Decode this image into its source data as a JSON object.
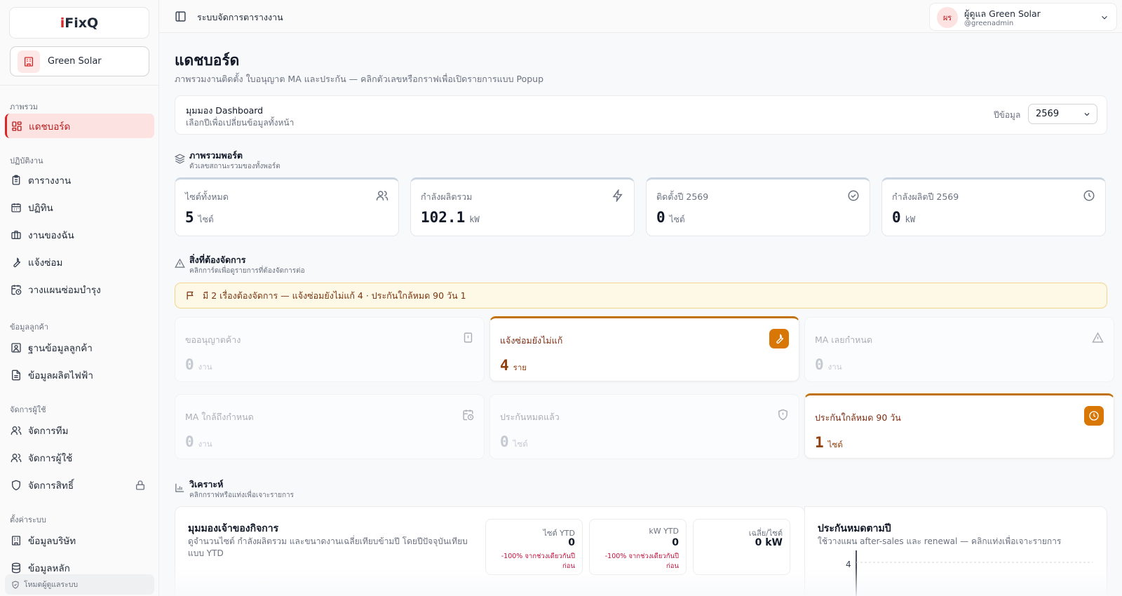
{
  "brand": {
    "logo_i": "i",
    "logo_rest": "FixQ"
  },
  "org": {
    "name": "Green Solar",
    "icon": "building-icon"
  },
  "sidebar": {
    "sections": [
      {
        "label": "ภาพรวม",
        "items": [
          {
            "label": "แดชบอร์ด",
            "icon": "dashboard-icon",
            "active": true
          }
        ]
      },
      {
        "label": "ปฏิบัติงาน",
        "items": [
          {
            "label": "ตารางงาน",
            "icon": "clipboard-icon"
          },
          {
            "label": "ปฏิทิน",
            "icon": "calendar-icon"
          },
          {
            "label": "งานของฉัน",
            "icon": "briefcase-icon"
          },
          {
            "label": "แจ้งซ่อม",
            "icon": "wrench-icon"
          },
          {
            "label": "วางแผนซ่อมบำรุง",
            "icon": "calendar-clock-icon"
          }
        ]
      },
      {
        "label": "ข้อมูลลูกค้า",
        "items": [
          {
            "label": "ฐานข้อมูลลูกค้า",
            "icon": "contact-icon"
          },
          {
            "label": "ข้อมูลผลิตไฟฟ้า",
            "icon": "document-icon"
          }
        ]
      },
      {
        "label": "จัดการผู้ใช้",
        "items": [
          {
            "label": "จัดการทีม",
            "icon": "users-icon"
          },
          {
            "label": "จัดการผู้ใช้",
            "icon": "users-icon"
          },
          {
            "label": "จัดการสิทธิ์",
            "icon": "shield-icon",
            "lock": true
          }
        ]
      },
      {
        "label": "ตั้งค่าระบบ",
        "items": [
          {
            "label": "ข้อมูลบริษัท",
            "icon": "building-icon"
          },
          {
            "label": "ข้อมูลหลัก",
            "icon": "database-icon"
          }
        ]
      }
    ],
    "footer": "โหมดผู้ดูแลระบบ"
  },
  "topbar": {
    "title": "ระบบจัดการตารางงาน"
  },
  "user": {
    "initials": "ผร",
    "name": "ผู้ดูแล Green Solar",
    "handle": "@greenadmin"
  },
  "page": {
    "title": "แดชบอร์ด",
    "subtitle": "ภาพรวมงานติดตั้ง ใบอนุญาต MA และประกัน — คลิกตัวเลขหรือกราฟเพื่อเปิดรายการแบบ Popup"
  },
  "dashboard_view": {
    "title": "มุมมอง Dashboard",
    "subtitle": "เลือกปีเพื่อเปลี่ยนข้อมูลทั้งหน้า",
    "year_label": "ปีข้อมูล",
    "year_value": "2569"
  },
  "portfolio": {
    "title": "ภาพรวมพอร์ต",
    "subtitle": "ตัวเลขสถานะรวมของทั้งพอร์ต",
    "cards": [
      {
        "label": "ไซต์ทั้งหมด",
        "value": "5",
        "unit": "ไซต์",
        "icon": "users-icon"
      },
      {
        "label": "กำลังผลิตรวม",
        "value": "102.1",
        "unit": "kW",
        "icon": "lightning-icon"
      },
      {
        "label": "ติดตั้งปี 2569",
        "value": "0",
        "unit": "ไซต์",
        "icon": "check-circle-icon"
      },
      {
        "label": "กำลังผลิตปี 2569",
        "value": "0",
        "unit": "kW",
        "icon": "clock-icon"
      }
    ]
  },
  "todo": {
    "title": "สิ่งที่ต้องจัดการ",
    "subtitle": "คลิกการ์ดเพื่อดูรายการที่ต้องจัดการต่อ",
    "alert": "มี 2 เรื่องต้องจัดการ — แจ้งซ่อมยังไม่แก้ 4 · ประกันใกล้หมด 90 วัน 1",
    "tiles": [
      {
        "label": "ขออนุญาตค้าง",
        "value": "0",
        "unit": "งาน",
        "icon": "alert-square-icon",
        "highlight": false
      },
      {
        "label": "แจ้งซ่อมยังไม่แก้",
        "value": "4",
        "unit": "ราย",
        "icon": "wrench-icon",
        "highlight": true
      },
      {
        "label": "MA เลยกำหนด",
        "value": "0",
        "unit": "งาน",
        "icon": "warning-triangle-icon",
        "highlight": false
      },
      {
        "label": "MA ใกล้ถึงกำหนด",
        "value": "0",
        "unit": "งาน",
        "icon": "calendar-clock-icon",
        "highlight": false
      },
      {
        "label": "ประกันหมดแล้ว",
        "value": "0",
        "unit": "ไซต์",
        "icon": "shield-alert-icon",
        "highlight": false
      },
      {
        "label": "ประกันใกล้หมด 90 วัน",
        "value": "1",
        "unit": "ไซต์",
        "icon": "clock-icon",
        "highlight": true
      }
    ]
  },
  "analysis": {
    "title": "วิเคราะห์",
    "subtitle": "คลิกกราฟหรือแท่งเพื่อเจาะรายการ",
    "owner_panel": {
      "title": "มุมมองเจ้าของกิจการ",
      "subtitle": "ดูจำนวนไซต์ กำลังผลิตรวม และขนาดงานเฉลี่ยเทียบข้ามปี โดยปีปัจจุบันเทียบแบบ YTD",
      "stats": [
        {
          "label": "ไซต์ YTD",
          "value": "0",
          "delta": "-100% จากช่วงเดียวกันปีก่อน"
        },
        {
          "label": "kW YTD",
          "value": "0",
          "delta": "-100% จากช่วงเดียวกันปีก่อน"
        },
        {
          "label": "เฉลี่ย/ไซต์",
          "value": "0 kW",
          "delta": ""
        }
      ]
    },
    "warranty_panel": {
      "title": "ประกันหมดตามปี",
      "subtitle": "ใช้วางแผน after-sales และ renewal — คลิกแท่งเพื่อเจาะรายการ"
    }
  },
  "chart_data": {
    "type": "bar",
    "title": "ประกันหมดตามปี",
    "y_tick_labels": [
      "4"
    ],
    "categories": [],
    "values": []
  }
}
